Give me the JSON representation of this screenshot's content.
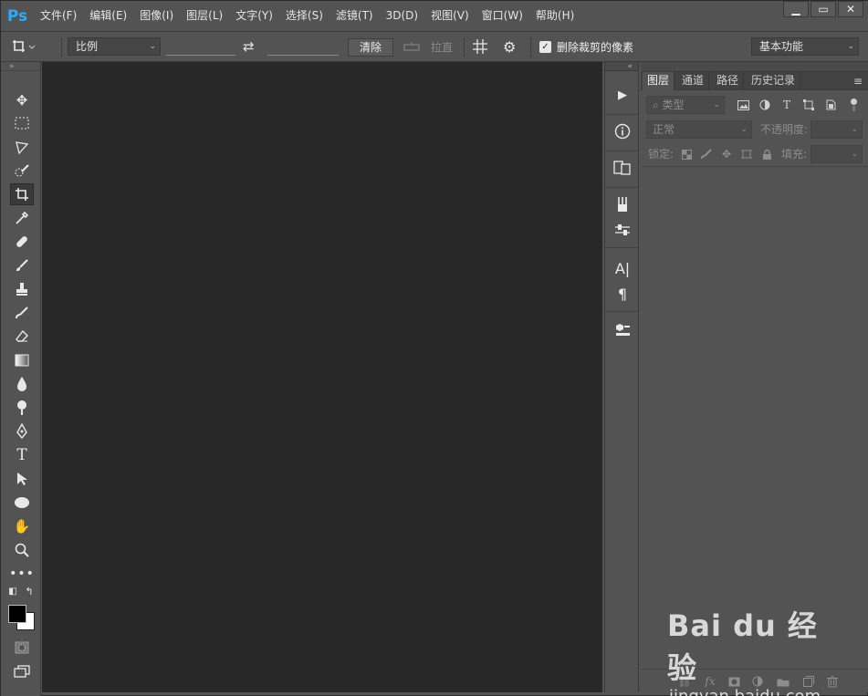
{
  "app": {
    "logo": "Ps"
  },
  "menu": [
    "文件(F)",
    "编辑(E)",
    "图像(I)",
    "图层(L)",
    "文字(Y)",
    "选择(S)",
    "滤镜(T)",
    "3D(D)",
    "视图(V)",
    "窗口(W)",
    "帮助(H)"
  ],
  "window_controls": {
    "minimize": "▁",
    "maximize": "▭",
    "close": "✕"
  },
  "options": {
    "ratio_select": "比例",
    "swap_icon": "⇄",
    "clear_button": "清除",
    "straighten_label": "拉直",
    "delete_cropped_label": "删除裁剪的像素",
    "delete_cropped_checked": true,
    "workspace_select": "基本功能"
  },
  "panel_tabs": [
    "图层",
    "通道",
    "路径",
    "历史记录"
  ],
  "layers": {
    "filter_kind": "类型",
    "blend_mode": "正常",
    "opacity_label": "不透明度:",
    "lock_label": "锁定:",
    "fill_label": "填充:"
  },
  "watermark": {
    "main": "Bai du 经验",
    "sub": "jingyan.baidu.com"
  },
  "colors": {
    "accent": "#31a8ff",
    "canvas": "#282828",
    "panel": "#535353"
  }
}
